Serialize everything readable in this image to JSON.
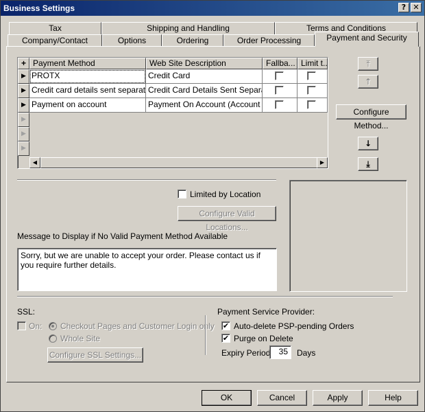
{
  "window": {
    "title": "Business Settings",
    "help_glyph": "?",
    "close_glyph": "✕"
  },
  "tabs": {
    "row_back": [
      "Tax",
      "Shipping and Handling",
      "Terms and Conditions"
    ],
    "row_front": [
      "Company/Contact",
      "Options",
      "Ordering",
      "Order Processing",
      "Payment and Security"
    ],
    "active": "Payment and Security"
  },
  "grid": {
    "add_glyph": "+",
    "columns": [
      "Payment Method",
      "Web Site Description",
      "Fallba...",
      "Limit t..."
    ],
    "rows": [
      {
        "method": "PROTX",
        "description": "Credit Card",
        "fallback": false,
        "limit": false
      },
      {
        "method": "Credit card details sent separately",
        "description": "Credit Card Details Sent Separat...",
        "fallback": false,
        "limit": false
      },
      {
        "method": "Payment on account",
        "description": "Payment On Account (Account ...",
        "fallback": false,
        "limit": false
      }
    ],
    "row_marker": "▶",
    "empty_rows": 3
  },
  "side_buttons": {
    "move_top": "⤒",
    "move_up": "↑",
    "configure_method": "Configure Method...",
    "move_down": "↓",
    "move_bottom": "⤓"
  },
  "location": {
    "limited_label": "Limited by Location",
    "limited_checked": false,
    "configure_locations": "Configure Valid Locations..."
  },
  "message": {
    "label": "Message to Display if No Valid Payment Method Available",
    "text": "Sorry, but we are unable to accept your order. Please contact us if you require further details."
  },
  "ssl": {
    "label": "SSL:",
    "on_label": "On:",
    "on_checked": false,
    "option_checkout": "Checkout Pages and Customer Login only",
    "option_whole": "Whole Site",
    "selected": "Checkout Pages and Customer Login only",
    "configure": "Configure SSL Settings..."
  },
  "psp": {
    "label": "Payment Service Provider:",
    "auto_delete_label": "Auto-delete PSP-pending Orders",
    "auto_delete_checked": true,
    "purge_label": "Purge on Delete",
    "purge_checked": true,
    "expiry_label": "Expiry Period:",
    "expiry_value": "35",
    "expiry_unit": "Days"
  },
  "footer": {
    "ok": "OK",
    "cancel": "Cancel",
    "apply": "Apply",
    "help": "Help"
  },
  "icons": {
    "scroll_left": "◀",
    "scroll_right": "▶",
    "check": "✔"
  }
}
